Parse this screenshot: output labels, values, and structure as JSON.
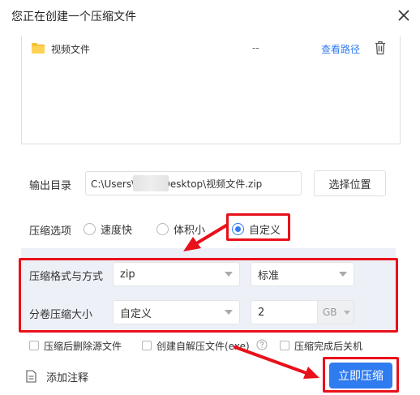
{
  "dialog": {
    "title": "您正在创建一个压缩文件"
  },
  "file_list": {
    "items": [
      {
        "name": "视频文件",
        "size": "--",
        "action": "查看路径"
      }
    ]
  },
  "output": {
    "label": "输出目录",
    "path": "C:\\Users\\        \\Desktop\\视频文件.zip",
    "choose_label": "选择位置"
  },
  "compress_options": {
    "label": "压缩选项",
    "choices": [
      "速度快",
      "体积小",
      "自定义"
    ],
    "selected": "自定义"
  },
  "custom": {
    "format_label": "压缩格式与方式",
    "format_value": "zip",
    "level_value": "标准",
    "volume_label": "分卷压缩大小",
    "volume_mode": "自定义",
    "volume_size": "2",
    "volume_unit": "GB"
  },
  "checkboxes": [
    {
      "label": "压缩后删除源文件",
      "checked": false
    },
    {
      "label": "创建自解压文件(exe)",
      "checked": false
    },
    {
      "label": "压缩完成后关机",
      "checked": false
    }
  ],
  "add_note_label": "添加注释",
  "compress_button_label": "立即压缩",
  "colors": {
    "accent": "#2f7bf0",
    "highlight_red": "#e8101a",
    "panel_bg": "#eef0f8"
  },
  "icons": [
    "close-icon",
    "folder-icon",
    "trash-icon",
    "help-icon",
    "note-icon"
  ]
}
